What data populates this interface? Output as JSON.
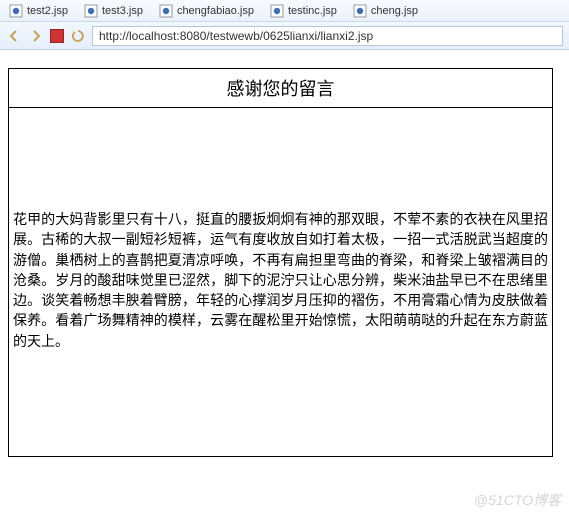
{
  "tabs": [
    {
      "label": "test2.jsp"
    },
    {
      "label": "test3.jsp"
    },
    {
      "label": "chengfabiao.jsp"
    },
    {
      "label": "testinc.jsp"
    },
    {
      "label": "cheng.jsp"
    }
  ],
  "url": "http://localhost:8080/testwewb/0625lianxi/lianxi2.jsp",
  "page": {
    "title": "感谢您的留言",
    "body": "花甲的大妈背影里只有十八，挺直的腰扳炯炯有神的那双眼，不荤不素的衣袂在风里招展。古稀的大叔一副短衫短裤，运气有度收放自如打着太极，一招一式活脱武当超度的游僧。巢栖树上的喜鹊把夏清凉呼唤，不再有扁担里弯曲的脊梁，和脊梁上皱褶满目的沧桑。岁月的酸甜味觉里已涩然，脚下的泥泞只让心思分辨，柴米油盐早已不在思绪里边。谈笑着畅想丰腴着臂膀，年轻的心撑润岁月压抑的褶伤，不用膏霜心情为皮肤做着保养。看着广场舞精神的模样，云雾在醒松里开始惊慌，太阳萌萌哒的升起在东方蔚蓝的天上。"
  },
  "watermark": "@51CTO博客"
}
